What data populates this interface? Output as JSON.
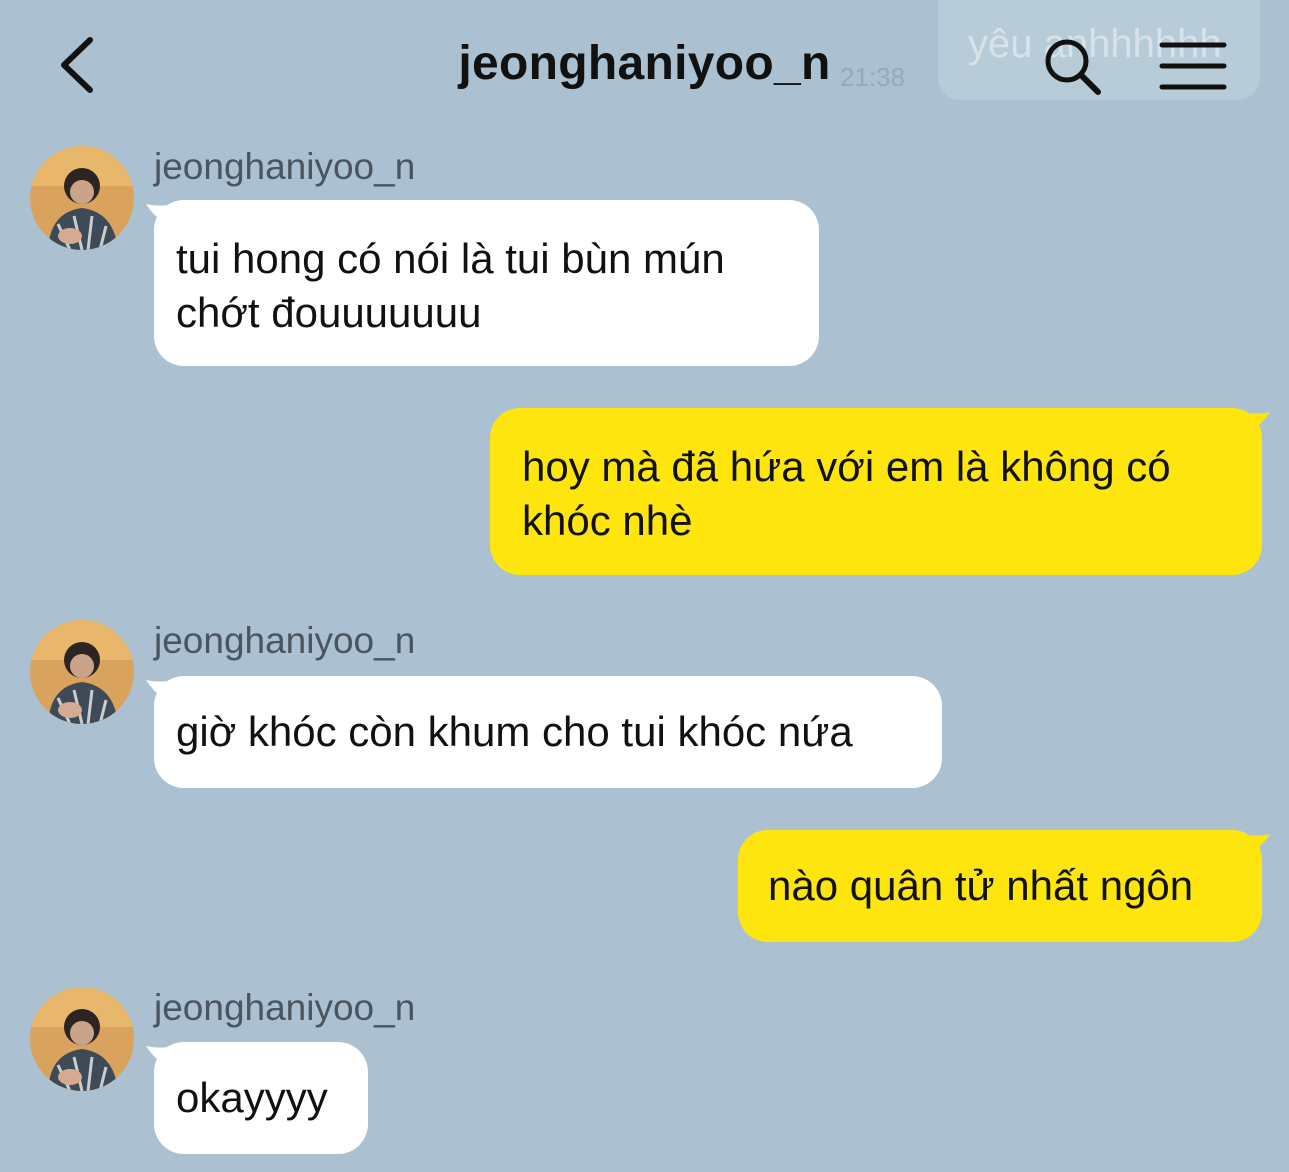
{
  "header": {
    "title": "jeonghaniyoo_n",
    "back_icon": "chevron-left-icon",
    "search_icon": "search-icon",
    "menu_icon": "hamburger-menu-icon",
    "ghost_message": "yêu anhhhhhh",
    "ghost_time": "21:38"
  },
  "colors": {
    "background": "#abc1d1",
    "incoming_bubble": "#ffffff",
    "outgoing_bubble": "#fde50d"
  },
  "messages": [
    {
      "direction": "in",
      "sender": "jeonghaniyoo_n",
      "text": "tui hong có nói là tui bùn mún chớt đouuuuuuu"
    },
    {
      "direction": "out",
      "text": "hoy mà đã hứa với em là không có khóc nhè"
    },
    {
      "direction": "in",
      "sender": "jeonghaniyoo_n",
      "text": "giờ khóc còn khum cho tui khóc nứa"
    },
    {
      "direction": "out",
      "text": "nào quân tử nhất ngôn"
    },
    {
      "direction": "in",
      "sender": "jeonghaniyoo_n",
      "text": "okayyyy"
    }
  ]
}
